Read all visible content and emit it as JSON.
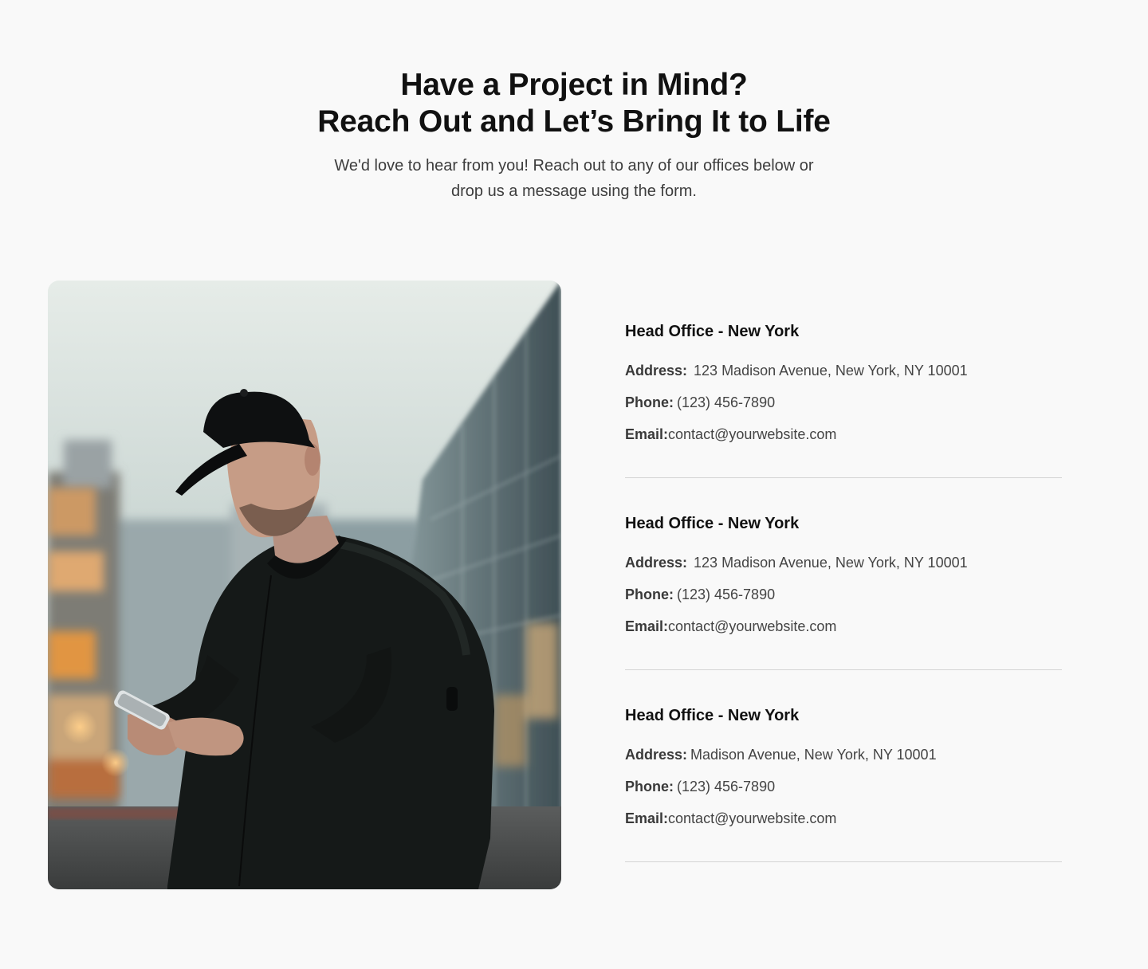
{
  "hero": {
    "title_line1": "Have a Project in Mind?",
    "title_line2": "Reach Out and Let’s Bring It to Life",
    "subtitle": "We'd love to hear from you! Reach out to any of our offices below or drop us a message using the form."
  },
  "image": {
    "alt": "Man in black cap and bomber jacket looking at his phone on a city street"
  },
  "offices": [
    {
      "title": "Head Office - New York",
      "address_label": "Address:",
      "address": "123 Madison Avenue, New York, NY 10001",
      "phone_label": "Phone:",
      "phone": "(123) 456-7890",
      "email_label": "Email:",
      "email": "contact@yourwebsite.com"
    },
    {
      "title": "Head Office - New York",
      "address_label": "Address:",
      "address": "123 Madison Avenue, New York, NY 10001",
      "phone_label": "Phone:",
      "phone": "(123) 456-7890",
      "email_label": "Email:",
      "email": "contact@yourwebsite.com"
    },
    {
      "title": "Head Office - New York",
      "address_label": "Address:",
      "address": "Madison Avenue, New York, NY 10001",
      "phone_label": "Phone:",
      "phone": "(123) 456-7890",
      "email_label": "Email:",
      "email": "contact@yourwebsite.com"
    }
  ]
}
